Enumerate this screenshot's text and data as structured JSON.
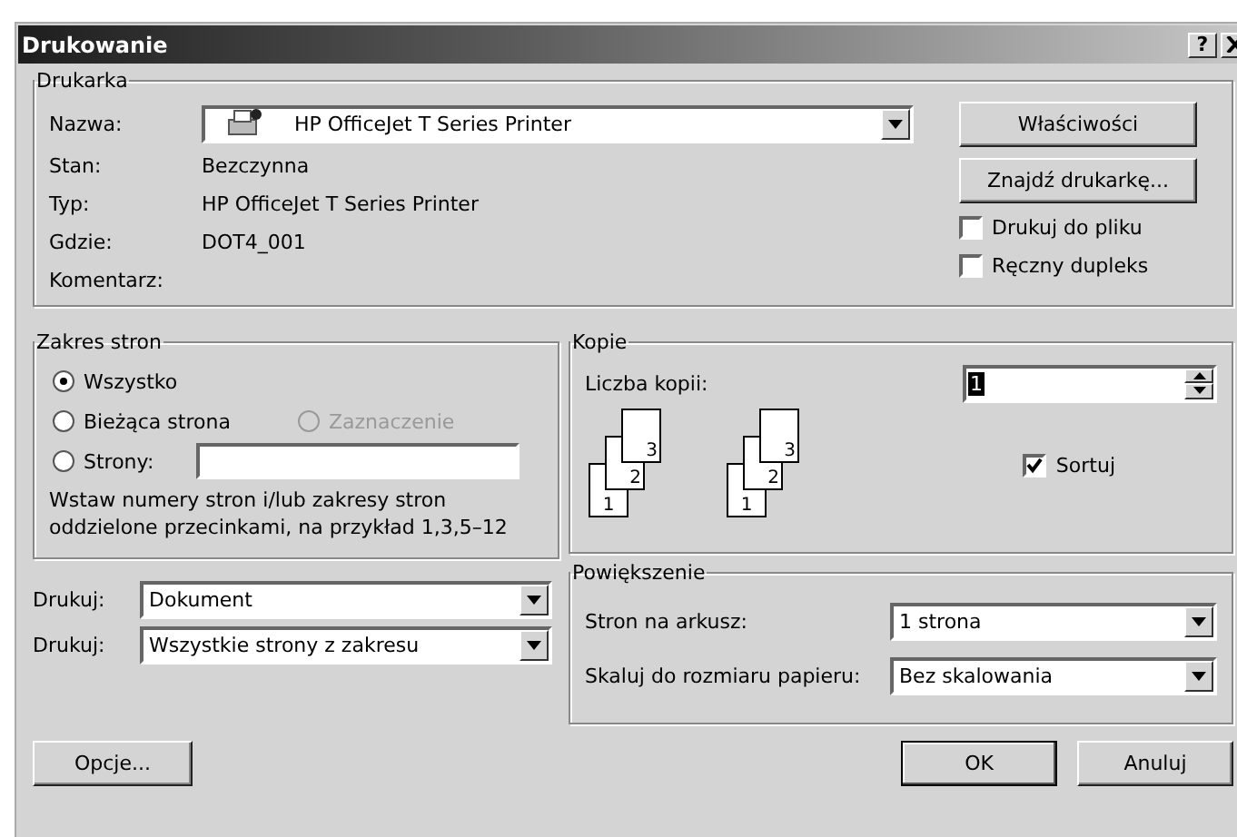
{
  "window": {
    "title": "Drukowanie",
    "help_button": "?"
  },
  "printer": {
    "title": "Drukarka",
    "name_label": "Nazwa:",
    "name_value": "HP OfficeJet T Series Printer",
    "fields": [
      {
        "label": "Stan:",
        "value": "Bezczynna"
      },
      {
        "label": "Typ:",
        "value": "HP OfficeJet T Series Printer"
      },
      {
        "label": "Gdzie:",
        "value": "DOT4_001"
      },
      {
        "label": "Komentarz:"
      }
    ],
    "properties_button": "Właściwości",
    "find_button": "Znajdź drukarkę...",
    "options": [
      {
        "label": "Drukuj do pliku",
        "checked": false
      },
      {
        "label": "Ręczny dupleks",
        "checked": false
      }
    ]
  },
  "range": {
    "title": "Zakres stron",
    "options": [
      {
        "label": "Wszystko",
        "selected": true,
        "disabled": false
      },
      {
        "label": "Bieżąca strona",
        "selected": false,
        "disabled": false
      },
      {
        "label": "Zaznaczenie",
        "selected": false,
        "disabled": true
      },
      {
        "label": "Strony:",
        "selected": false,
        "disabled": false
      }
    ],
    "hint": "Wstaw numery stron i/lub zakresy stron oddzielone przecinkami, na przykład 1,3,5–12"
  },
  "copies": {
    "title": "Kopie",
    "count_label": "Liczba kopii:",
    "count_value": "1",
    "stacks": [
      [
        "1",
        "2",
        "3"
      ],
      [
        "1",
        "2",
        "3"
      ]
    ],
    "collate": {
      "label": "Sortuj",
      "checked": true
    }
  },
  "print_what": [
    {
      "label": "Drukuj:",
      "value": "Dokument"
    },
    {
      "label": "Drukuj:",
      "value": "Wszystkie strony z zakresu"
    }
  ],
  "zoom": {
    "title": "Powiększenie",
    "rows": [
      {
        "label": "Stron na arkusz:",
        "value": "1 strona"
      },
      {
        "label": "Skaluj do rozmiaru papieru:",
        "value": "Bez skalowania"
      }
    ]
  },
  "buttons": {
    "options": "Opcje...",
    "ok": "OK",
    "cancel": "Anuluj"
  }
}
